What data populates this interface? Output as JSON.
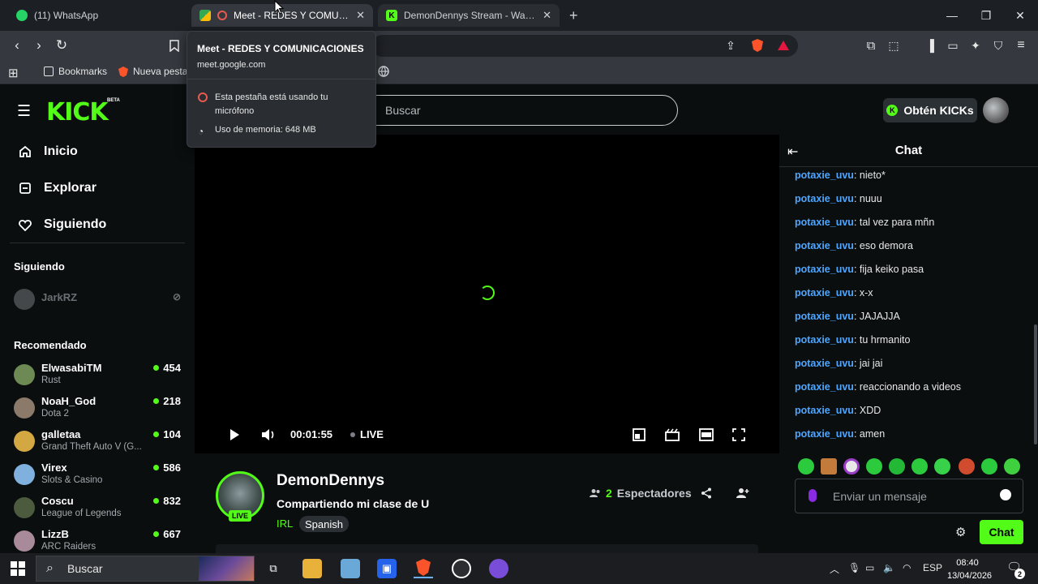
{
  "browser": {
    "tabs": [
      {
        "label": "(11) WhatsApp",
        "active": false
      },
      {
        "label": "Meet - REDES Y COMUNICAC",
        "active": true
      },
      {
        "label": "DemonDennys Stream - Watch l",
        "active": false
      }
    ],
    "new_tab": "+",
    "bookmarks": [
      {
        "label": "Bookmarks"
      },
      {
        "label": "Nueva pesta"
      }
    ]
  },
  "tooltip": {
    "title": "Meet - REDES Y COMUNICACIONES",
    "url": "meet.google.com",
    "mic_notice": "Esta pestaña está usando tu micrófono",
    "memory": "Uso de memoria: 648 MB"
  },
  "kick": {
    "logo": "KICK",
    "logo_badge": "BETA",
    "search_placeholder": "Buscar",
    "kicks_button": "Obtén KICKs"
  },
  "sidebar": {
    "nav": [
      {
        "label": "Inicio",
        "icon": "home-icon"
      },
      {
        "label": "Explorar",
        "icon": "compass-icon"
      },
      {
        "label": "Siguiendo",
        "icon": "heart-icon"
      }
    ],
    "following_heading": "Siguiendo",
    "following": [
      {
        "name": "JarkRZ"
      }
    ],
    "recommended_heading": "Recomendado",
    "recommended": [
      {
        "name": "ElwasabiTM",
        "game": "Rust",
        "viewers": "454",
        "color": "#6d8a55"
      },
      {
        "name": "NoaH_God",
        "game": "Dota 2",
        "viewers": "218",
        "color": "#8b7a6a"
      },
      {
        "name": "galletaa",
        "game": "Grand Theft Auto V (G...",
        "viewers": "104",
        "color": "#d3a843"
      },
      {
        "name": "Virex",
        "game": "Slots & Casino",
        "viewers": "586",
        "color": "#7fb0de"
      },
      {
        "name": "Coscu",
        "game": "League of Legends",
        "viewers": "832",
        "color": "#4c5a3e"
      },
      {
        "name": "LizzB",
        "game": "ARC Raiders",
        "viewers": "667",
        "color": "#a98a9a"
      }
    ]
  },
  "player": {
    "time": "00:01:55",
    "live_label": "LIVE"
  },
  "stream": {
    "streamer": "DemonDennys",
    "live_badge": "LIVE",
    "title": "Compartiendo mi clase de U",
    "category": "IRL",
    "language": "Spanish",
    "viewers_count": "2",
    "viewers_label": "Espectadores"
  },
  "chat": {
    "title": "Chat",
    "messages": [
      {
        "user": "potaxie_uvu",
        "text": ": nieto*"
      },
      {
        "user": "potaxie_uvu",
        "text": ": nuuu"
      },
      {
        "user": "potaxie_uvu",
        "text": ": tal vez para mñn"
      },
      {
        "user": "potaxie_uvu",
        "text": ": eso demora"
      },
      {
        "user": "potaxie_uvu",
        "text": ": fija keiko pasa"
      },
      {
        "user": "potaxie_uvu",
        "text": ": x-x"
      },
      {
        "user": "potaxie_uvu",
        "text": ": JAJAJJA"
      },
      {
        "user": "potaxie_uvu",
        "text": ": tu hrmanito"
      },
      {
        "user": "potaxie_uvu",
        "text": ": jai jai"
      },
      {
        "user": "potaxie_uvu",
        "text": ": reaccionando a videos"
      },
      {
        "user": "potaxie_uvu",
        "text": ": XDD"
      },
      {
        "user": "potaxie_uvu",
        "text": ": amen"
      }
    ],
    "input_placeholder": "Enviar un mensaje",
    "send_label": "Chat"
  },
  "taskbar": {
    "search_placeholder": "Buscar",
    "lang": "ESP",
    "time": "08:40",
    "date": "13/04/2026",
    "notifications": "2"
  },
  "colors": {
    "accent": "#53fc18",
    "username": "#4ea6ff",
    "background": "#0b0e0f"
  }
}
